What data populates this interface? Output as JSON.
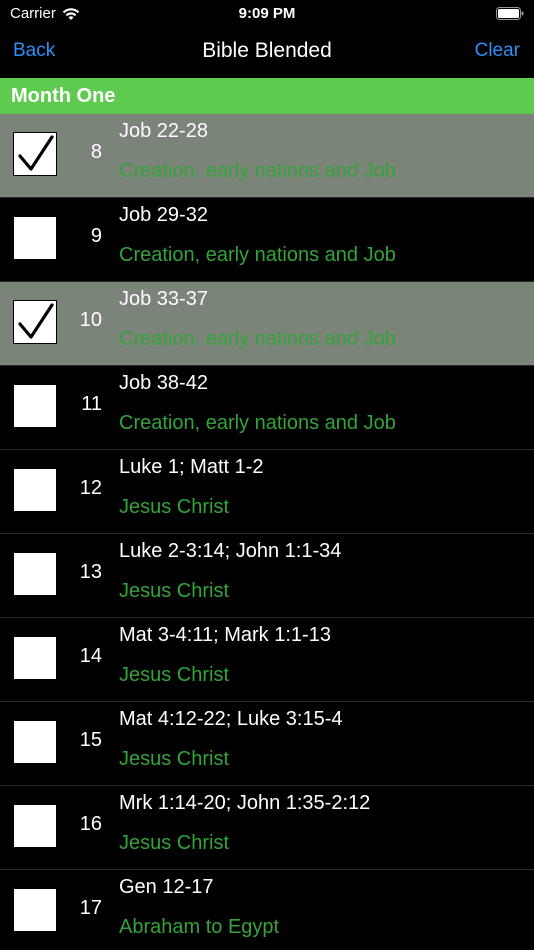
{
  "status": {
    "carrier": "Carrier",
    "time": "9:09 PM"
  },
  "nav": {
    "back_label": "Back",
    "title": "Bible Blended",
    "clear_label": "Clear"
  },
  "section": {
    "title": "Month One"
  },
  "colors": {
    "accent_blue": "#2f8ff7",
    "section_green": "#5ecb50",
    "theme_green": "#34a33a",
    "checked_row": "#7b8478"
  },
  "readings": [
    {
      "day": "8",
      "passage": "Job 22-28",
      "theme": "Creation, early nations and Job",
      "checked": true
    },
    {
      "day": "9",
      "passage": "Job 29-32",
      "theme": "Creation, early nations and Job",
      "checked": false
    },
    {
      "day": "10",
      "passage": "Job 33-37",
      "theme": "Creation, early nations and Job",
      "checked": true
    },
    {
      "day": "11",
      "passage": "Job 38-42",
      "theme": "Creation, early nations and Job",
      "checked": false
    },
    {
      "day": "12",
      "passage": "Luke 1; Matt 1-2",
      "theme": "Jesus Christ",
      "checked": false
    },
    {
      "day": "13",
      "passage": "Luke 2-3:14; John 1:1-34",
      "theme": "Jesus Christ",
      "checked": false
    },
    {
      "day": "14",
      "passage": "Mat 3-4:11; Mark 1:1-13",
      "theme": "Jesus Christ",
      "checked": false
    },
    {
      "day": "15",
      "passage": "Mat 4:12-22; Luke 3:15-4",
      "theme": "Jesus Christ",
      "checked": false
    },
    {
      "day": "16",
      "passage": "Mrk 1:14-20; John 1:35-2:12",
      "theme": "Jesus Christ",
      "checked": false
    },
    {
      "day": "17",
      "passage": "Gen 12-17",
      "theme": "Abraham to Egypt",
      "checked": false
    }
  ]
}
